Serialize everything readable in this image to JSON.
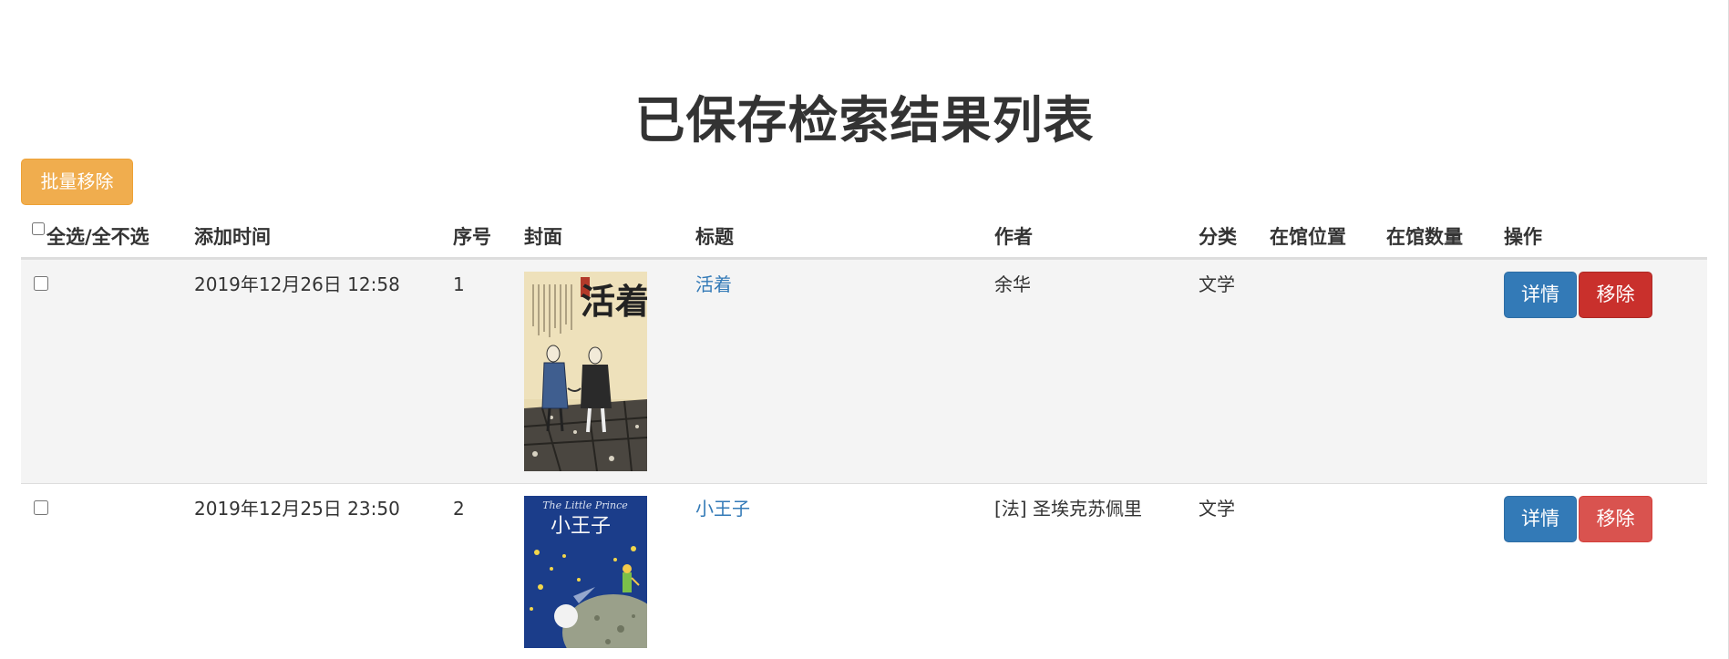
{
  "page": {
    "title": "已保存检索结果列表",
    "batch_remove_label": "批量移除"
  },
  "table": {
    "headers": {
      "select_all": "全选/全不选",
      "added_time": "添加时间",
      "index": "序号",
      "cover": "封面",
      "book_title": "标题",
      "author": "作者",
      "category": "分类",
      "location": "在馆位置",
      "quantity": "在馆数量",
      "actions": "操作"
    },
    "rows": [
      {
        "added_time": "2019年12月26日 12:58",
        "index": "1",
        "cover": {
          "title_text": "活着",
          "palette": [
            "#e9dcb4",
            "#2b2b2b",
            "#3f5e8f"
          ]
        },
        "book_title": "活着",
        "author": "余华",
        "category": "文学",
        "location": "",
        "quantity": "",
        "detail_label": "详情",
        "remove_label": "移除"
      },
      {
        "added_time": "2019年12月25日 23:50",
        "index": "2",
        "cover": {
          "title_text": "小王子",
          "subtitle_text": "The Little Prince",
          "palette": [
            "#1b3d8a",
            "#f2d64b",
            "#9aa08a"
          ]
        },
        "book_title": "小王子",
        "author": "[法] 圣埃克苏佩里",
        "category": "文学",
        "location": "",
        "quantity": "",
        "detail_label": "详情",
        "remove_label": "移除"
      }
    ]
  },
  "colors": {
    "warning": "#f0ad4e",
    "primary": "#337ab7",
    "danger": "#d9534f",
    "danger_active": "#c9302c",
    "link": "#337ab7",
    "stripe": "#f4f4f4"
  }
}
